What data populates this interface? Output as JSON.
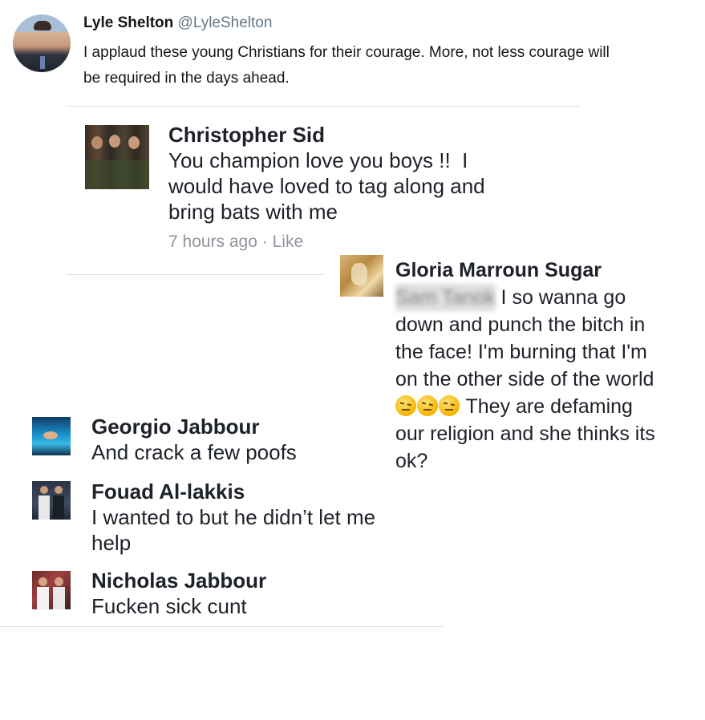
{
  "tweet": {
    "name": "Lyle Shelton",
    "handle": "@LyleShelton",
    "text_line1": "I applaud these young Christians for their courage. More, not less courage will",
    "text_line2": "be required in the days ahead."
  },
  "comment_sid": {
    "name": "Christopher Sid",
    "line1": "You champion love you boys !!  I",
    "line2": "would have loved to tag along and",
    "line3": "bring bats with me",
    "time": "7 hours ago",
    "separator": "·",
    "like": "Like"
  },
  "comment_gloria": {
    "name": "Gloria Marroun Sugar",
    "redacted_tag": "Sam Tanok",
    "line1": " I so wanna go",
    "line2": "down and punch the bitch in",
    "line3": "the face! I'm burning that I'm",
    "line4": "on the other side of the world",
    "line5_suffix": " They are defaming",
    "line6": "our religion and she thinks its",
    "line7": "ok?"
  },
  "comment_georgio": {
    "name": "Georgio Jabbour",
    "text": "And crack a few poofs"
  },
  "comment_fouad": {
    "name": "Fouad Al-lakkis",
    "line1": "I wanted to but he didn’t let me",
    "line2": "help"
  },
  "comment_nicholas": {
    "name": "Nicholas Jabbour",
    "text": "Fucken sick cunt"
  }
}
